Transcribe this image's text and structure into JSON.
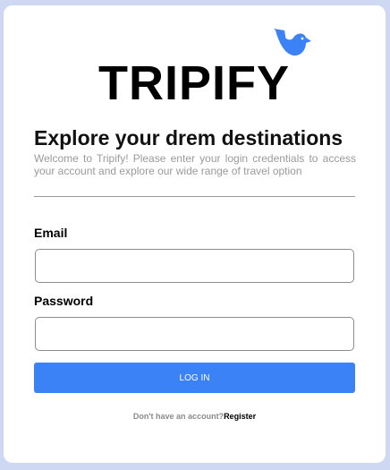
{
  "brand": {
    "name": "TRIPIFY",
    "bird_color": "#3b82f6"
  },
  "intro": {
    "heading": "Explore your drem destinations",
    "description": "Welcome to Tripify! Please enter your login credentials to access your account and explore our wide range of travel option"
  },
  "form": {
    "email_label": "Email",
    "email_value": "",
    "password_label": "Password",
    "password_value": "",
    "submit_label": "LOG IN"
  },
  "footer": {
    "prompt": "Don't have an account?",
    "register_label": "Register"
  },
  "colors": {
    "page_background": "#cfd8f3",
    "button": "#3b82f6"
  }
}
